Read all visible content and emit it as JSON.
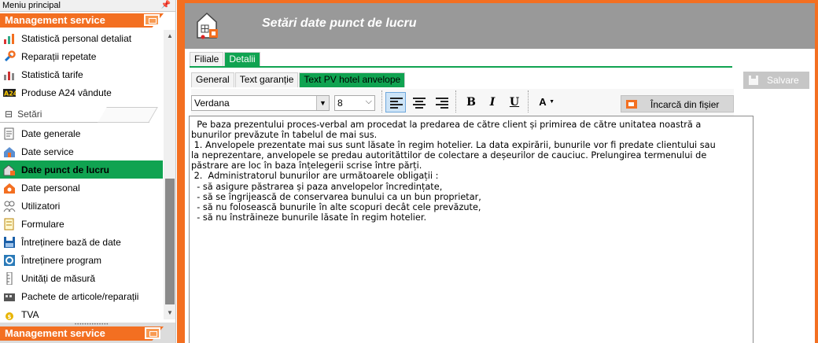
{
  "nav": {
    "panel_title": "Meniu principal",
    "pin": "ꟷ",
    "group_title": "Management service",
    "items_top": [
      {
        "label": "Statistică personal detaliat",
        "icon": "people-chart-icon"
      },
      {
        "label": "Reparații repetate",
        "icon": "repair-icon"
      },
      {
        "label": "Statistică tarife",
        "icon": "tariff-chart-icon"
      },
      {
        "label": "Produse A24 vândute",
        "icon": "a24-icon"
      }
    ],
    "section_title": "Setări",
    "items": [
      {
        "label": "Date generale",
        "icon": "general-data-icon"
      },
      {
        "label": "Date service",
        "icon": "service-data-icon"
      },
      {
        "label": "Date punct de lucru",
        "icon": "workpoint-icon",
        "active": true
      },
      {
        "label": "Date personal",
        "icon": "personnel-icon"
      },
      {
        "label": "Utilizatori",
        "icon": "users-icon"
      },
      {
        "label": "Formulare",
        "icon": "forms-icon"
      },
      {
        "label": "Întreținere bază de date",
        "icon": "database-icon"
      },
      {
        "label": "Întreținere program",
        "icon": "program-maintenance-icon"
      },
      {
        "label": "Unități de măsură",
        "icon": "ruler-icon"
      },
      {
        "label": "Pachete de articole/reparații",
        "icon": "packages-icon"
      },
      {
        "label": "TVA",
        "icon": "vat-icon"
      }
    ],
    "bottom_group_title": "Management service"
  },
  "header": {
    "title": "Setări date punct de lucru"
  },
  "tabs_level1": [
    "Filiale",
    "Detalii"
  ],
  "tabs_level2": [
    "General",
    "Text garanție",
    "Text PV hotel anvelope"
  ],
  "toolbar": {
    "font": "Verdana",
    "size": "8",
    "bold": "B",
    "italic": "I",
    "underline": "U",
    "font_color": "A",
    "load_label": "Încarcă din fișier"
  },
  "save_label": "Salvare",
  "editor": {
    "lines": [
      "  Pe baza prezentului proces-verbal am procedat la predarea de către client și primirea de către unitatea noastră a",
      "bunurilor prevăzute în tabelul de mai sus.",
      " 1. Anvelopele prezentate mai sus sunt lăsate în regim hotelier. La data expirării, bunurile vor fi predate clientului sau",
      "la neprezentare, anvelopele se predau autorităttilor de colectare a deșeurilor de cauciuc. Prelungirea termenului de",
      "păstrare are loc în baza înțelegerii scrise între părți.",
      " 2.  Administratorul bunurilor are următoarele obligații :",
      "  - să asigure păstrarea și paza anvelopelor încredințate,",
      "  - să se îngrijească de conservarea bunului ca un bun proprietar,",
      "  - să nu folosească bunurile în alte scopuri decât cele prevăzute,",
      "  - să nu înstrăineze bunurile lăsate în regim hotelier."
    ]
  },
  "colors": {
    "accent_orange": "#f36f21",
    "active_green": "#10a351",
    "header_gray": "#999999"
  }
}
